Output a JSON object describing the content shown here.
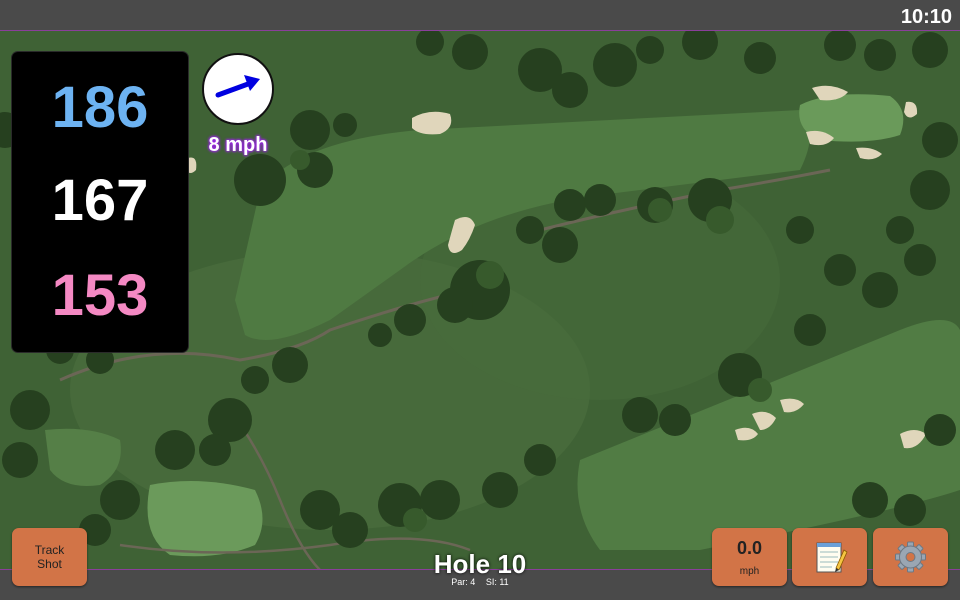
{
  "status_bar": {
    "time": "10:10"
  },
  "distances": {
    "back": "186",
    "middle": "167",
    "front": "153",
    "colors": {
      "back": "#6db3f2",
      "middle": "#ffffff",
      "front": "#f489c3"
    }
  },
  "wind": {
    "speed": "8 mph",
    "icon": "wind-arrow-icon",
    "arrow_color": "#0000e0"
  },
  "buttons": {
    "track_shot": "Track Shot",
    "speed_value": "0.0",
    "speed_unit": "mph",
    "notes_icon": "notepad-icon",
    "settings_icon": "gear-icon",
    "color": "#d27447"
  },
  "hole": {
    "title": "Hole 10",
    "par": "Par: 4",
    "si": "SI: 11"
  }
}
